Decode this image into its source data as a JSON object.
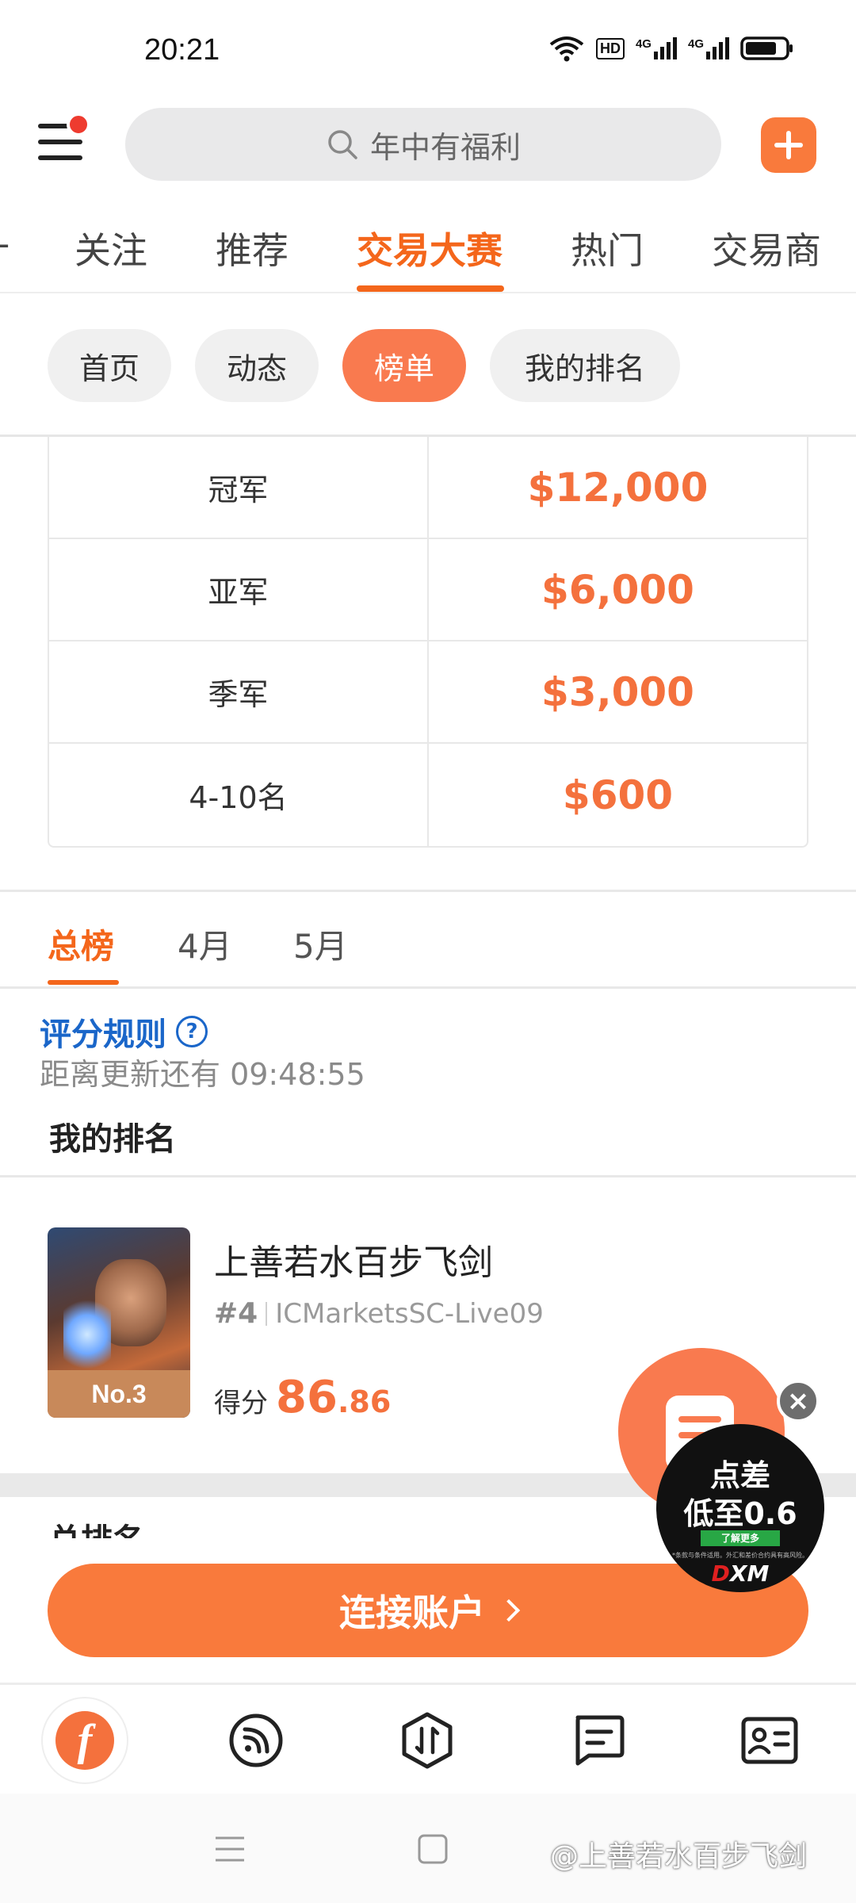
{
  "status_bar": {
    "time": "20:21",
    "hd_label": "HD",
    "net1": "4G",
    "net2": "4G"
  },
  "header": {
    "search_placeholder": "年中有福利"
  },
  "top_tabs": [
    {
      "label": "计"
    },
    {
      "label": "关注"
    },
    {
      "label": "推荐"
    },
    {
      "label": "交易大赛",
      "active": true
    },
    {
      "label": "热门"
    },
    {
      "label": "交易商"
    }
  ],
  "pills": [
    {
      "label": "首页"
    },
    {
      "label": "动态"
    },
    {
      "label": "榜单",
      "active": true
    },
    {
      "label": "我的排名"
    }
  ],
  "prize_table": [
    {
      "place": "冠军",
      "prize": "$12,000"
    },
    {
      "place": "亚军",
      "prize": "$6,000"
    },
    {
      "place": "季军",
      "prize": "$3,000"
    },
    {
      "place": "4-10名",
      "prize": "$600"
    }
  ],
  "ranking_tabs": [
    {
      "label": "总榜",
      "active": true
    },
    {
      "label": "4月"
    },
    {
      "label": "5月"
    }
  ],
  "rules": {
    "label": "评分规则",
    "help": "?"
  },
  "countdown": "距离更新还有 09:48:55",
  "my_rank_title": "我的排名",
  "user_card": {
    "badge": "No.3",
    "name": "上善若水百步飞剑",
    "rank": "#4",
    "server": "ICMarketsSC-Live09",
    "score_label": "得分",
    "score_int": "86",
    "score_dec": ".86"
  },
  "next_section_title": "总排名",
  "ad": {
    "line1": "点差",
    "line2": "低至0.6",
    "button": "了解更多",
    "fine_print": "*条款与条件适用。外汇和差价合约具有高风险。",
    "brand_prefix": "D",
    "brand": "XM"
  },
  "cta": {
    "label": "连接账户"
  },
  "bottom_nav": [
    {
      "name": "home"
    },
    {
      "name": "feed"
    },
    {
      "name": "trade"
    },
    {
      "name": "messages"
    },
    {
      "name": "profile"
    }
  ],
  "watermark": "@上善若水百步飞剑",
  "colors": {
    "accent": "#f4661b",
    "button": "#f97a3c",
    "link": "#1a66c9"
  }
}
